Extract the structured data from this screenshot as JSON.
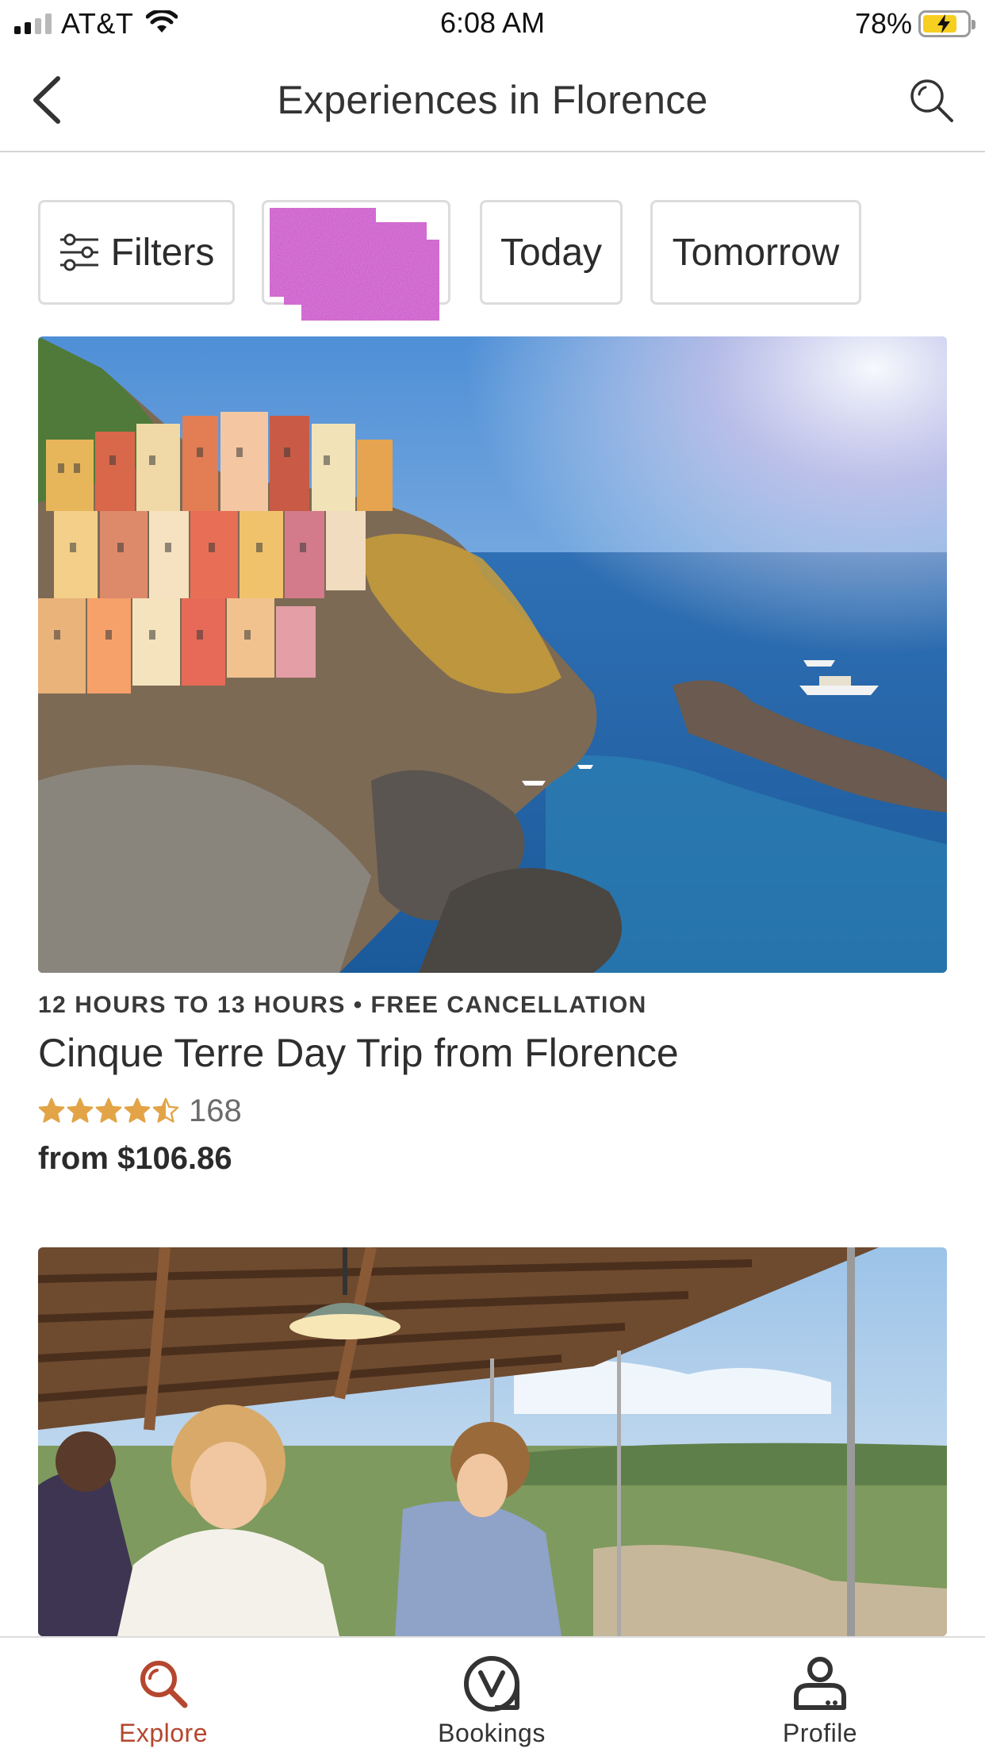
{
  "status_bar": {
    "carrier": "AT&T",
    "time": "6:08 AM",
    "battery_percent": "78%",
    "battery_level": 0.78,
    "signal_bars": 2,
    "charging": true
  },
  "header": {
    "title": "Experiences in Florence",
    "back_icon": "chevron-left-icon",
    "search_icon": "search-icon"
  },
  "filters": {
    "filters_label": "Filters",
    "filters_icon": "sliders-icon",
    "today_label": "Today",
    "tomorrow_label": "Tomorrow"
  },
  "listings": [
    {
      "image": "cinque-terre-coastal-village-photo",
      "meta": "12 HOURS TO 13 HOURS • FREE CANCELLATION",
      "title": "Cinque Terre Day Trip from Florence",
      "rating": 4.5,
      "review_count": "168",
      "price": "from $106.86"
    },
    {
      "image": "tuscan-cooking-class-photo"
    }
  ],
  "tabs": [
    {
      "label": "Explore",
      "icon": "search-icon",
      "active": true
    },
    {
      "label": "Bookings",
      "icon": "bookings-icon",
      "active": false
    },
    {
      "label": "Profile",
      "icon": "profile-icon",
      "active": false
    }
  ],
  "colors": {
    "accent": "#b5472f",
    "star": "#e2a446",
    "border": "#dcdcdc"
  }
}
